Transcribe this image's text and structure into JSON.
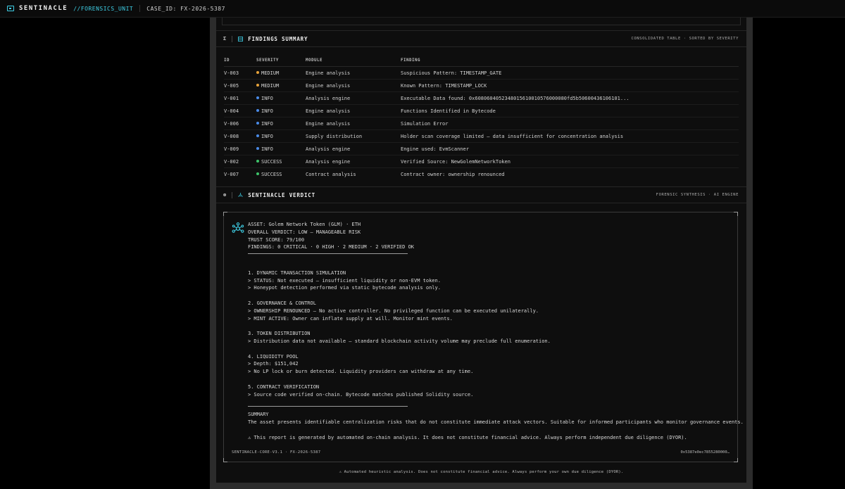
{
  "header": {
    "brand": "SENTINACLE",
    "unit": "//FORENSICS_UNIT",
    "case_id": "CASE_ID: FX-2026-5387"
  },
  "findings": {
    "number": "Σ",
    "title": "FINDINGS SUMMARY",
    "meta": "CONSOLIDATED TABLE · SORTED BY SEVERITY",
    "columns": [
      "ID",
      "SEVERITY",
      "MODULE",
      "FINDING"
    ],
    "severity_colors": {
      "MEDIUM": "#e8a33a",
      "INFO": "#4a8be8",
      "SUCCESS": "#3dc46a"
    },
    "rows": [
      {
        "id": "V-003",
        "severity": "MEDIUM",
        "module": "Engine analysis",
        "finding": "Suspicious Pattern: TIMESTAMP_GATE"
      },
      {
        "id": "V-005",
        "severity": "MEDIUM",
        "module": "Engine analysis",
        "finding": "Known Pattern: TIMESTAMP_LOCK"
      },
      {
        "id": "V-001",
        "severity": "INFO",
        "module": "Analysis engine",
        "finding": "Executable Data found: 0x6080604052348015610010576000080fd5b50600436106101..."
      },
      {
        "id": "V-004",
        "severity": "INFO",
        "module": "Engine analysis",
        "finding": "Functions Identified in Bytecode"
      },
      {
        "id": "V-006",
        "severity": "INFO",
        "module": "Engine analysis",
        "finding": "Simulation Error"
      },
      {
        "id": "V-008",
        "severity": "INFO",
        "module": "Supply distribution",
        "finding": "Holder scan coverage limited — data insufficient for concentration analysis"
      },
      {
        "id": "V-009",
        "severity": "INFO",
        "module": "Analysis engine",
        "finding": "Engine used: EvmScanner"
      },
      {
        "id": "V-002",
        "severity": "SUCCESS",
        "module": "Analysis engine",
        "finding": "Verified Source: NewGolemNetworkToken"
      },
      {
        "id": "V-007",
        "severity": "SUCCESS",
        "module": "Contract analysis",
        "finding": "Contract owner: ownership renounced"
      }
    ]
  },
  "verdict": {
    "number": "⊛",
    "title": "SENTINACLE VERDICT",
    "meta": "FORENSIC SYNTHESIS · AI ENGINE",
    "head_lines": [
      "ASSET: Golem Network Token (GLM) · ETH",
      "OVERALL VERDICT: LOW — MANAGEABLE RISK",
      "TRUST SCORE: 79/100",
      "FINDINGS: 0 CRITICAL · 0 HIGH · 2 MEDIUM · 2 VERIFIED OK"
    ],
    "sections": [
      {
        "heading": "1. DYNAMIC TRANSACTION SIMULATION",
        "lines": [
          "> STATUS: Not executed — insufficient liquidity or non-EVM token.",
          "> Honeypot detection performed via static bytecode analysis only."
        ]
      },
      {
        "heading": "2. GOVERNANCE & CONTROL",
        "lines": [
          "> OWNERSHIP RENOUNCED — No active controller. No privileged function can be executed unilaterally.",
          "> MINT ACTIVE: Owner can inflate supply at will. Monitor mint events."
        ]
      },
      {
        "heading": "3. TOKEN DISTRIBUTION",
        "lines": [
          "> Distribution data not available — standard blockchain activity volume may preclude full enumeration."
        ]
      },
      {
        "heading": "4. LIQUIDITY POOL",
        "lines": [
          "> Depth: $151,042",
          "> No LP lock or burn detected. Liquidity providers can withdraw at any time."
        ]
      },
      {
        "heading": "5. CONTRACT VERIFICATION",
        "lines": [
          "> Source code verified on-chain. Bytecode matches published Solidity source."
        ]
      }
    ],
    "summary_label": "SUMMARY",
    "summary_text": "The asset presents identifiable centralization risks that do not constitute immediate attack vectors. Suitable for informed participants who monitor governance events.",
    "warning": "⚠ This report is generated by automated on-chain analysis. It does not constitute financial advice. Always perform independent due diligence (DYOR).",
    "footer_left": "SENTINACLE-CORE-V3.1 · FX-2026-5387",
    "footer_right": "0x5387e0ec7855280000…"
  },
  "disclaimer": "⚠ Automated heuristic analysis. Does not constitute financial advice. Always perform your own due diligence (DYOR)."
}
